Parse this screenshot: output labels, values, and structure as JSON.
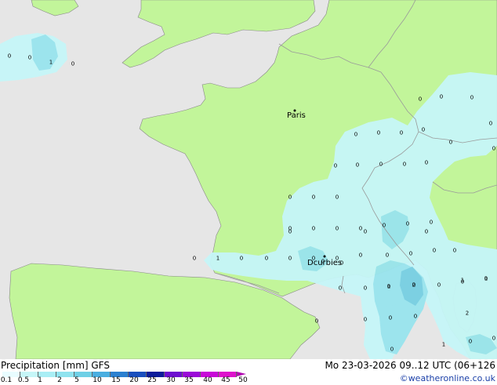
{
  "map": {
    "colors": {
      "sea": "#e6e6e6",
      "land": "#c2f59a",
      "light_precip": "#c6f6f8",
      "medium_precip": "#99e4ee",
      "heavy_precip": "#77cfe2",
      "border": "#9a9a9a",
      "coast": "#888888"
    },
    "cities": [
      {
        "name": "Paris"
      },
      {
        "name": "Dcurbies"
      }
    ],
    "values": [
      "0",
      "0",
      "1",
      "0",
      "0",
      "0",
      "0",
      "0",
      "0",
      "0",
      "0",
      "0",
      "0",
      "0",
      "0",
      "0",
      "0",
      "0",
      "0",
      "0",
      "0",
      "0",
      "0",
      "0",
      "0",
      "0",
      "0",
      "0",
      "0",
      "0",
      "0",
      "1",
      "0",
      "0",
      "0",
      "0",
      "0",
      "0",
      "0",
      "0",
      "0",
      "0",
      "0",
      "0",
      "0",
      "0",
      "0",
      "0",
      "1",
      "2",
      "1",
      "1",
      "0",
      "0",
      "0",
      "0",
      "2",
      "0",
      "1",
      "0",
      "0",
      "0",
      "0",
      "0",
      "0",
      "0"
    ]
  },
  "footer": {
    "title": "Precipitation [mm]  GFS",
    "datetime": "Mo 23-03-2026 09..12 UTC (06+126",
    "credit": "©weatheronline.co.uk",
    "legend": {
      "ticks": [
        "0.1",
        "0.5",
        "1",
        "2",
        "5",
        "10",
        "15",
        "20",
        "25",
        "30",
        "35",
        "40",
        "45",
        "50"
      ],
      "colors": [
        "#e8fcff",
        "#c6f6f8",
        "#a9eef5",
        "#8fe3ef",
        "#6fd0e6",
        "#4aaee0",
        "#2b80d0",
        "#1a4fbe",
        "#0c1c9a",
        "#6e0fd0",
        "#9b0ad8",
        "#c80ad8",
        "#de12cc",
        "#b00ab0"
      ]
    }
  }
}
